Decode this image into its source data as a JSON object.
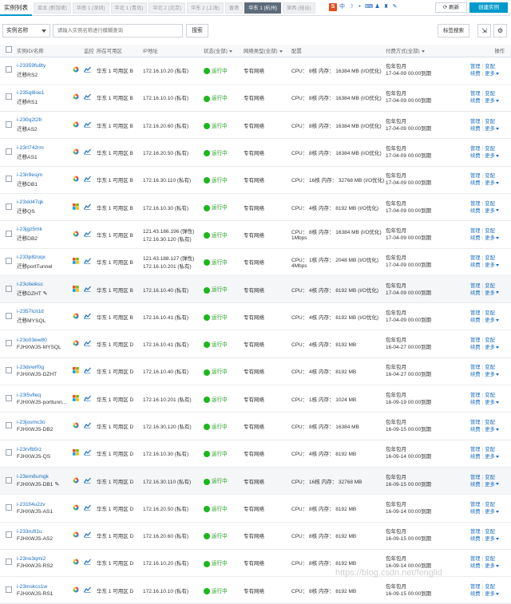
{
  "page": {
    "title": "实例列表",
    "refresh_label": "刷新",
    "create_label": "创建实例"
  },
  "regions": [
    {
      "label": "亚太 (新加坡)"
    },
    {
      "label": "华南 1 (深圳)"
    },
    {
      "label": "华北 1 (青岛)"
    },
    {
      "label": "华北 2 (北京)"
    },
    {
      "label": "华东 2 (上海)"
    },
    {
      "label": "香港"
    },
    {
      "label": "华东 1 (杭州)",
      "active": true
    },
    {
      "label": "美西 (硅谷)"
    }
  ],
  "search": {
    "field_label": "实例名称",
    "placeholder": "请输入实例名称进行模糊查询",
    "button_label": "搜索",
    "tag_button_label": "标签搜索"
  },
  "columns": {
    "id_name": "实例ID/名称",
    "monitor": "监控",
    "zone": "所在可用区",
    "ip": "IP地址",
    "status": "状态(全部)",
    "network": "网络类型(全部)",
    "config": "配置",
    "billing": "付费方式(全部)",
    "ops": "操作"
  },
  "actions": {
    "manage": "管理",
    "upgrade": "变配",
    "renew": "续费",
    "more": "更多"
  },
  "rows": [
    {
      "id": "i-23359fu8ty",
      "name": "迁移RS2",
      "os": "other",
      "zone": "华东 1 可用区 B",
      "ip1": "172.16.10.20 (私有)",
      "ip2": "",
      "status": "运行中",
      "network": "专有网络",
      "config": "CPU： 8核    内存： 16384 MB (I/O优化)",
      "config2": "",
      "bill1": "包年包月",
      "bill2": "17-04-09 00:00到期",
      "edit": false
    },
    {
      "id": "i-235ql8oe1",
      "name": "迁移RS1",
      "os": "other",
      "zone": "华东 1 可用区 B",
      "ip1": "172.16.10.10 (私有)",
      "ip2": "",
      "status": "运行中",
      "network": "专有网络",
      "config": "CPU： 8核    内存： 16384 MB (I/O优化)",
      "config2": "",
      "bill1": "包年包月",
      "bill2": "17-04-09 00:00到期",
      "edit": false
    },
    {
      "id": "i-230q2t2fr",
      "name": "迁移AS2",
      "os": "other",
      "zone": "华东 1 可用区 B",
      "ip1": "172.16.20.60 (私有)",
      "ip2": "",
      "status": "运行中",
      "network": "专有网络",
      "config": "CPU： 8核    内存： 16384 MB (I/O优化)",
      "config2": "",
      "bill1": "包年包月",
      "bill2": "17-04-09 00:00到期",
      "edit": false
    },
    {
      "id": "i-23rt742rm",
      "name": "迁移AS1",
      "os": "other",
      "zone": "华东 1 可用区 B",
      "ip1": "172.16.20.50 (私有)",
      "ip2": "",
      "status": "运行中",
      "network": "专有网络",
      "config": "CPU： 8核    内存： 16384 MB (I/O优化)",
      "config2": "",
      "bill1": "包年包月",
      "bill2": "17-04-09 00:00到期",
      "edit": false
    },
    {
      "id": "i-23ir9esjm",
      "name": "迁移DB1",
      "os": "other",
      "zone": "华东 1 可用区 B",
      "ip1": "172.16.30.110 (私有)",
      "ip2": "",
      "status": "运行中",
      "network": "专有网络",
      "config": "CPU： 16核    内存： 32768 MB (I/O优化)",
      "config2": "",
      "bill1": "包年包月",
      "bill2": "17-04-09 00:00到期",
      "edit": false
    },
    {
      "id": "i-23xkl47qk",
      "name": "迁移QS",
      "os": "windows",
      "zone": "华东 1 可用区 B",
      "ip1": "172.16.10.30 (私有)",
      "ip2": "",
      "status": "运行中",
      "network": "专有网络",
      "config": "CPU： 4核    内存： 8192 MB (I/O优化)",
      "config2": "",
      "bill1": "包年包月",
      "bill2": "17-04-09 00:00到期",
      "edit": false
    },
    {
      "id": "i-23jgz5mk",
      "name": "迁移DB2",
      "os": "other",
      "zone": "华东 1 可用区 B",
      "ip1": "121.43.186.196 (弹性)",
      "ip2": "172.16.30.120 (私有)",
      "status": "运行中",
      "network": "专有网络",
      "config": "CPU： 8核    内存： 16384 MB (I/O优化)",
      "config2": "1Mbps",
      "bill1": "包年包月",
      "bill2": "17-04-09 00:00到期",
      "edit": false
    },
    {
      "id": "i-233p8zoqx",
      "name": "迁移portTunnel",
      "os": "windows",
      "zone": "华东 1 可用区 B",
      "ip1": "121.43.188.127 (弹性)",
      "ip2": "172.16.10.201 (私有)",
      "status": "运行中",
      "network": "专有网络",
      "config": "CPU： 1核    内存： 2048 MB (I/O优化)",
      "config2": "4Mbps",
      "bill1": "包年包月",
      "bill2": "17-04-09 00:00到期",
      "edit": false
    },
    {
      "id": "i-23otieiksc",
      "name": "迁移DZHT",
      "os": "windows",
      "zone": "华东 1 可用区 B",
      "ip1": "172.16.10.40 (私有)",
      "ip2": "",
      "status": "运行中",
      "network": "专有网络",
      "config": "CPU： 4核    内存： 8192 MB (I/O优化)",
      "config2": "",
      "bill1": "包年包月",
      "bill2": "17-04-09 00:00到期",
      "edit": true
    },
    {
      "id": "i-2357lcit1d",
      "name": "迁移MYSQL",
      "os": "other",
      "zone": "华东 1 可用区 B",
      "ip1": "172.16.10.41 (私有)",
      "ip2": "",
      "status": "运行中",
      "network": "专有网络",
      "config": "CPU： 4核    内存： 8192 MB (I/O优化)",
      "config2": "",
      "bill1": "包年包月",
      "bill2": "17-04-09 00:00到期",
      "edit": false
    },
    {
      "id": "i-23o03ew80",
      "name": "FJHXWJS-MYSQL",
      "os": "other",
      "zone": "华东 1 可用区 D",
      "ip1": "172.16.10.41 (私有)",
      "ip2": "",
      "status": "运行中",
      "network": "专有网络",
      "config": "CPU： 4核    内存： 8192 MB",
      "config2": "",
      "bill1": "包年包月",
      "bill2": "16-04-27 00:00到期",
      "edit": false
    },
    {
      "id": "i-23dvwrf0g",
      "name": "FJHXWJS-DZHT",
      "os": "windows",
      "zone": "华东 1 可用区 D",
      "ip1": "172.16.10.40 (私有)",
      "ip2": "",
      "status": "运行中",
      "network": "专有网络",
      "config": "CPU： 4核    内存： 8192 MB",
      "config2": "",
      "bill1": "包年包月",
      "bill2": "16-04-27 00:00到期",
      "edit": false
    },
    {
      "id": "i-23l5vfleq",
      "name": "FJHXWJS-porttunn...",
      "os": "windows",
      "zone": "华东 1 可用区 D",
      "ip1": "172.16.10.201 (私有)",
      "ip2": "",
      "status": "运行中",
      "network": "专有网络",
      "config": "CPU： 1核    内存： 1024 MB",
      "config2": "",
      "bill1": "包年包月",
      "bill2": "16-09-19 00:00到期",
      "edit": false
    },
    {
      "id": "i-23josmc3o",
      "name": "FJHXWJS-DB2",
      "os": "other",
      "zone": "华东 1 可用区 D",
      "ip1": "172.16.30.120 (私有)",
      "ip2": "",
      "status": "运行中",
      "network": "专有网络",
      "config": "CPU： 8核    内存： 16384 MB",
      "config2": "",
      "bill1": "包年包月",
      "bill2": "16-09-15 00:00到期",
      "edit": false
    },
    {
      "id": "i-23rvfb5rz",
      "name": "FJHXWJS-QS",
      "os": "windows",
      "zone": "华东 1 可用区 D",
      "ip1": "172.16.10.30 (私有)",
      "ip2": "",
      "status": "运行中",
      "network": "专有网络",
      "config": "CPU： 4核    内存： 8192 MB",
      "config2": "",
      "bill1": "包年包月",
      "bill2": "16-09-14 00:00到期",
      "edit": false
    },
    {
      "id": "i-23em8umgk",
      "name": "FJHXWJS-DB1",
      "os": "other",
      "zone": "华东 1 可用区 D",
      "ip1": "172.16.30.110 (私有)",
      "ip2": "",
      "status": "运行中",
      "network": "专有网络",
      "config": "CPU： 16核    内存： 32768 MB",
      "config2": "",
      "bill1": "包年包月",
      "bill2": "16-09-15 00:00到期",
      "edit": true
    },
    {
      "id": "i-231fi4u2zv",
      "name": "FJHXWJS-AS1",
      "os": "other",
      "zone": "华东 1 可用区 D",
      "ip1": "172.16.20.50 (私有)",
      "ip2": "",
      "status": "运行中",
      "network": "专有网络",
      "config": "CPU： 8核    内存： 8192 MB",
      "config2": "",
      "bill1": "包年包月",
      "bill2": "16-09-14 00:00到期",
      "edit": false
    },
    {
      "id": "i-233ruft1u",
      "name": "FJHXWJS-AS2",
      "os": "other",
      "zone": "华东 1 可用区 D",
      "ip1": "172.16.20.60 (私有)",
      "ip2": "",
      "status": "运行中",
      "network": "专有网络",
      "config": "CPU： 8核    内存： 8192 MB",
      "config2": "",
      "bill1": "包年包月",
      "bill2": "16-09-15 00:00到期",
      "edit": false
    },
    {
      "id": "i-23no3qmi2",
      "name": "FJHXWJS-RS2",
      "os": "other",
      "zone": "华东 1 可用区 D",
      "ip1": "172.16.10.20 (私有)",
      "ip2": "",
      "status": "运行中",
      "network": "专有网络",
      "config": "CPU： 8核    内存： 8192 MB",
      "config2": "",
      "bill1": "包年包月",
      "bill2": "16-09-14 00:00到期",
      "edit": false
    },
    {
      "id": "i-23mskcs1w",
      "name": "FJHXWJS-RS1",
      "os": "other",
      "zone": "华东 1 可用区 D",
      "ip1": "172.16.10.10 (私有)",
      "ip2": "",
      "status": "运行中",
      "network": "专有网络",
      "config": "CPU： 8核    内存： 8192 MB",
      "config2": "",
      "bill1": "包年包月",
      "bill2": "16-09-15 00:00到期",
      "edit": false
    }
  ],
  "watermark": "https://blog.csdn.net/fenglid"
}
